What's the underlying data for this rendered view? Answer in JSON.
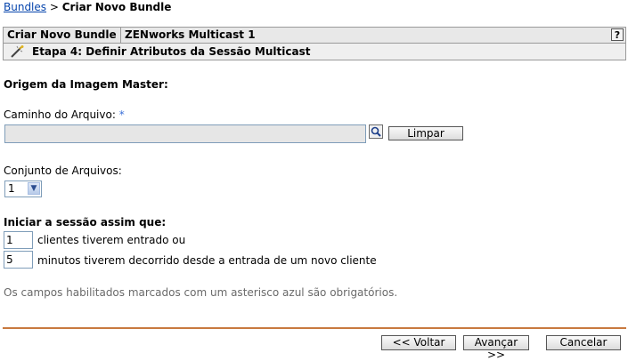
{
  "breadcrumb": {
    "root": "Bundles",
    "separator": ">",
    "current": "Criar Novo Bundle"
  },
  "header": {
    "col1": "Criar Novo Bundle",
    "col2": "ZENworks Multicast 1",
    "help": "?"
  },
  "step": {
    "title": "Etapa 4: Definir Atributos da Sessão Multicast"
  },
  "form": {
    "section_title": "Origem da Imagem Master:",
    "path_label": "Caminho do Arquivo:",
    "required_mark": "*",
    "path_value": "",
    "clear_button": "Limpar",
    "fileset_label": "Conjunto de Arquivos:",
    "fileset_value": "1",
    "start_title": "Iniciar a sessão assim que:",
    "clients_value": "1",
    "clients_label": "clientes tiverem entrado ou",
    "minutes_value": "5",
    "minutes_label": "minutos tiverem decorrido desde a entrada de um novo cliente",
    "required_note": "Os campos habilitados marcados com um asterisco azul são obrigatórios."
  },
  "footer": {
    "back": "<< Voltar",
    "next": "Avançar >>",
    "cancel": "Cancelar"
  },
  "colors": {
    "divider": "#c8793f",
    "required": "#3a6fd8",
    "link": "#0645ad"
  }
}
